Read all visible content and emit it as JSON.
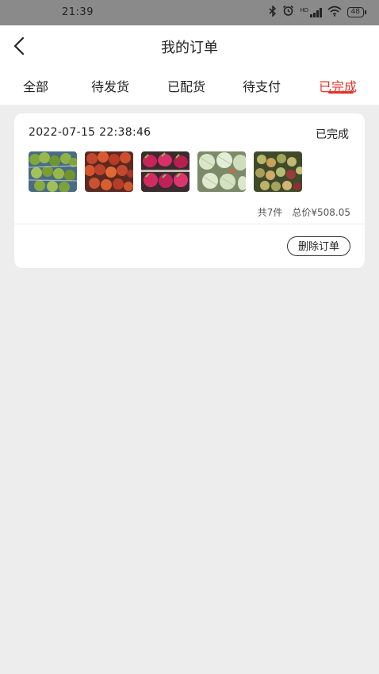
{
  "status_bar": {
    "time": "21:39",
    "network": "HD",
    "battery": "48"
  },
  "nav": {
    "title": "我的订单"
  },
  "tabs": [
    {
      "label": "全部"
    },
    {
      "label": "待发货"
    },
    {
      "label": "已配货"
    },
    {
      "label": "待支付"
    },
    {
      "label": "已完成",
      "active": true
    }
  ],
  "order": {
    "time": "2022-07-15 22:38:46",
    "status": "已完成",
    "count": "共7件",
    "total": "总价¥508.05",
    "delete_label": "删除订单",
    "thumbnails": [
      "green-fruit-box",
      "lychee-basket",
      "dragon-fruit-crate",
      "melon-mesh-crate",
      "mixed-fruit-basket"
    ]
  },
  "colors": {
    "accent": "#e0332a",
    "background": "#ededed",
    "status_bar": "#8a8a8a"
  }
}
